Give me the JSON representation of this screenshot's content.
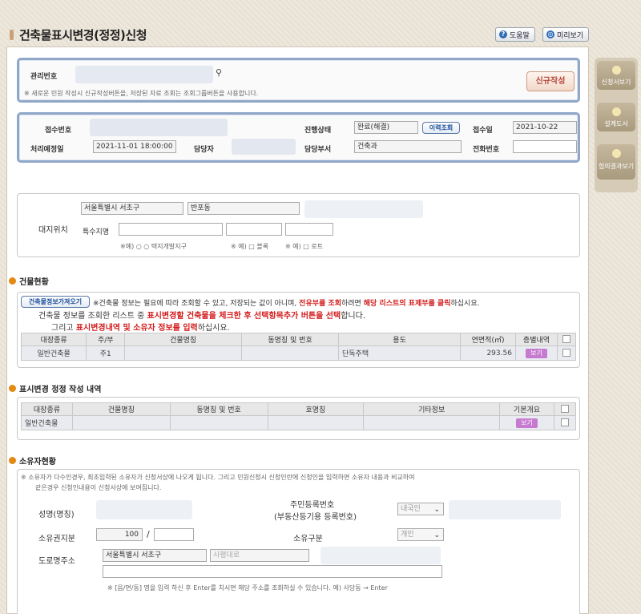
{
  "page": {
    "title": "건축물표시변경(정정)신청"
  },
  "toolbar": {
    "help_label": "도움말",
    "preview_label": "미리보기"
  },
  "rail": {
    "items": [
      "신청서보기",
      "설계도서",
      "협의결과보기"
    ]
  },
  "management": {
    "label": "관리번호",
    "note": "※ 새로운 민원 작성시 신규작성버튼을, 저장된 자료 조회는 조회그룹버튼을 사용합니다.",
    "new_button": "신규작성"
  },
  "receipt": {
    "receipt_no_label": "접수번호",
    "status_label": "진행상태",
    "status_value": "완료(해결)",
    "history_button": "이력조회",
    "receipt_date_label": "접수일",
    "receipt_date_value": "2021-10-22",
    "due_label": "처리예정일",
    "due_value": "2021-11-01 18:00:00",
    "manager_label": "담당자",
    "dept_label": "담당부서",
    "dept_value": "건축과",
    "phone_label": "전화번호"
  },
  "site": {
    "label": "대지위치",
    "city": "서울특별시 서초구",
    "dong": "반포동",
    "special_label": "특수지명",
    "hint1": "※예) ○ ○ 택지개발지구",
    "hint2": "※ 예) □ 블록",
    "hint3": "※ 예) □ 로트"
  },
  "building_status": {
    "title": "건물현황",
    "fetch_button": "건축물정보가져오기",
    "desc_line1_a": "※건축물 정보는 필요에 따라 조회할 수 있고, 저장되는 값이 아니며,",
    "desc_line1_b": "전유부를 조회",
    "desc_line1_c": "하려면",
    "desc_line1_d": "해당 리스트의 표제부를 클릭",
    "desc_line1_e": "하십시요.",
    "desc_line2_a": "건축물 정보를 조회한 리스트 중",
    "desc_line2_b": "표시변경할 건축물을 체크한 후 선택항목추가 버튼을 선택",
    "desc_line2_c": "합니다.",
    "desc_line3_a": "그리고",
    "desc_line3_b": "표시변경내역 및 소유자 정보를 입력",
    "desc_line3_c": "하십시요.",
    "headers": [
      "대장종류",
      "주/부",
      "건물명칭",
      "동명칭 및 번호",
      "용도",
      "연면적(㎡)",
      "층별내역"
    ],
    "row": {
      "type": "일반건축물",
      "main_sub": "주1",
      "name": "",
      "dong": "",
      "use": "단독주택",
      "area": "293.56",
      "view": "보기"
    }
  },
  "display_change": {
    "title": "표시변경 정정 작성 내역",
    "headers": [
      "대장종류",
      "건물명칭",
      "동명칭 및 번호",
      "호명칭",
      "기타정보",
      "기본개요"
    ],
    "row": {
      "type": "일반건축물",
      "view": "보기"
    }
  },
  "owner": {
    "title": "소유자현황",
    "note_line1": "※ 소유자가 다수인경우, 최초입력된 소유자가 신청서상에 나오게 됩니다. 그리고 민원신청시 신청인란에 신청인을 입력하면 소유자 내용과 비교하여",
    "note_line2": "같은경우 신청인내용이 신청서상에 보여집니다.",
    "name_label": "성명(명칭)",
    "reg_label_1": "주민등록번호",
    "reg_label_2": "(부동산등기용 등록번호)",
    "nationality": "내국인",
    "share_label": "소유권지분",
    "share_value": "100",
    "share_sep": "/",
    "type_label": "소유구분",
    "type_value": "개인",
    "road_label": "도로명주소",
    "road_city": "서울특별시 서초구",
    "road_name": "사평대로",
    "road_note": "※ [읍/면/동] 명을 입력 하신 후 Enter를 치시면 해당 주소를 조회하실 수 있습니다. 예) 사당동 → Enter"
  }
}
